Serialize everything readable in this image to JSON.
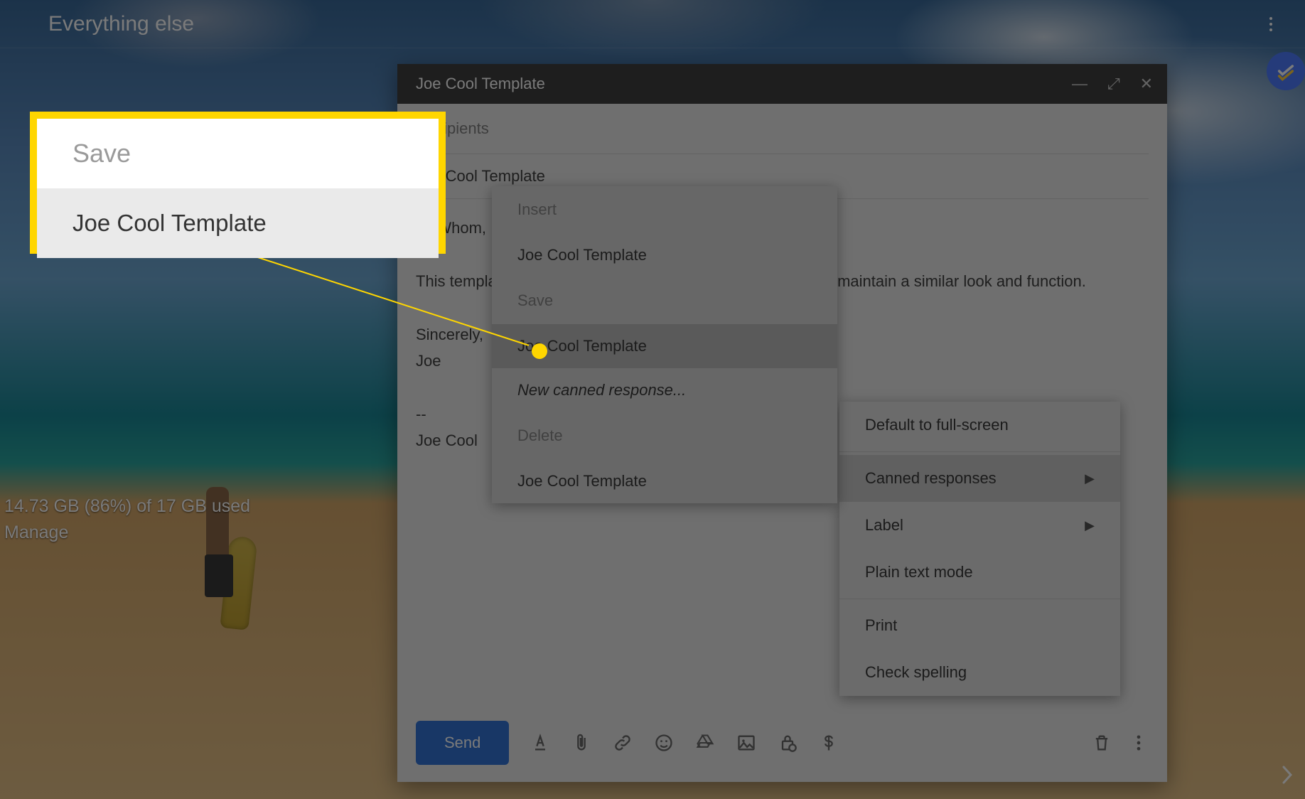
{
  "header": {
    "title": "Everything else"
  },
  "storage": {
    "line1": "14.73 GB (86%) of 17 GB used",
    "line2": "Manage"
  },
  "compose": {
    "title": "Joe Cool Template",
    "recipients_placeholder": "Recipients",
    "subject": "Joe Cool Template",
    "greeting": "To Whom,",
    "body_line1": "This template is used for all correspondence where I want to maintain a similar look and function.",
    "signoff1": "Sincerely,",
    "signoff2": "Joe",
    "sigsep": "--",
    "sig": "Joe Cool",
    "send_label": "Send"
  },
  "ctx1": {
    "items": [
      {
        "label": "Default to full-screen",
        "arrow": false,
        "hl": false
      },
      {
        "label": "Canned responses",
        "arrow": true,
        "hl": true
      },
      {
        "label": "Label",
        "arrow": true,
        "hl": false
      },
      {
        "label": "Plain text mode",
        "arrow": false,
        "hl": false
      },
      {
        "label": "Print",
        "arrow": false,
        "hl": false
      },
      {
        "label": "Check spelling",
        "arrow": false,
        "hl": false
      }
    ]
  },
  "ctx2": {
    "insert_hdr": "Insert",
    "insert_item": "Joe Cool Template",
    "save_hdr": "Save",
    "save_item": "Joe Cool Template",
    "new_item": "New canned response...",
    "delete_hdr": "Delete",
    "delete_item": "Joe Cool Template"
  },
  "callout": {
    "save": "Save",
    "template": "Joe Cool Template"
  }
}
